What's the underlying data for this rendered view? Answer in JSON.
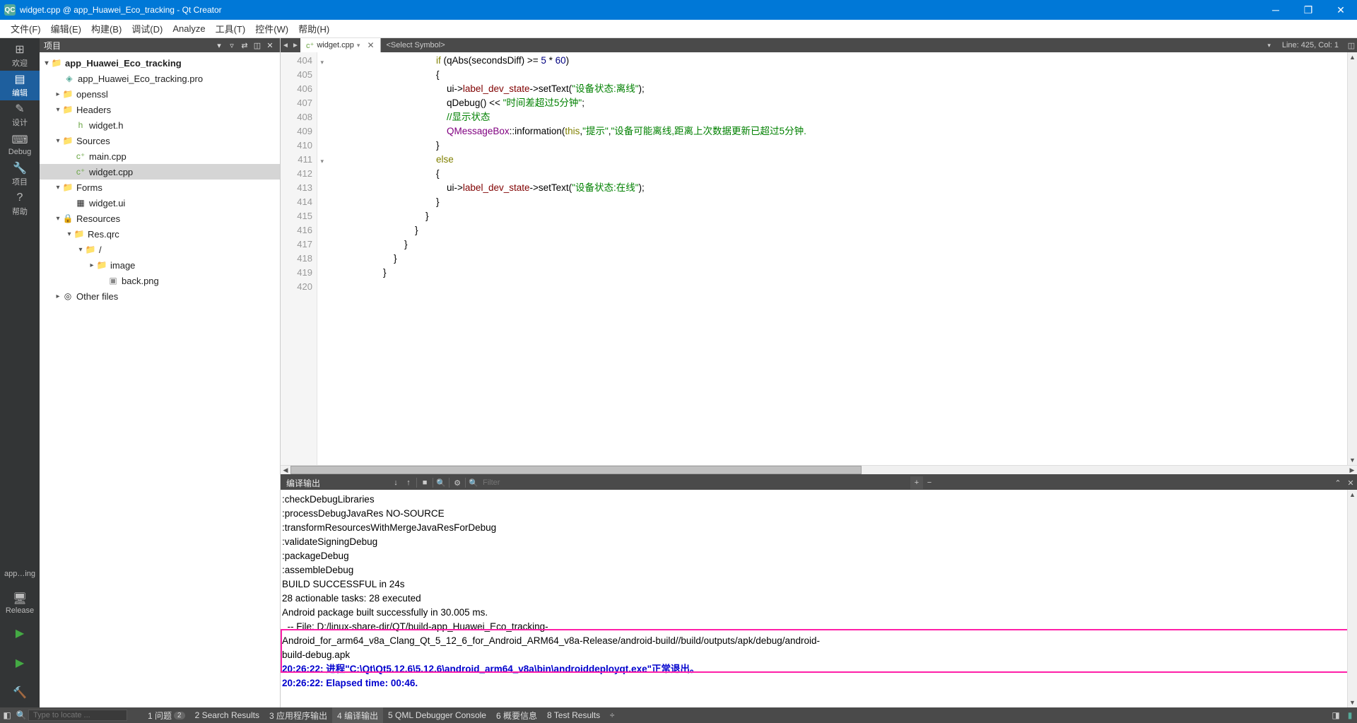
{
  "window": {
    "title": "widget.cpp @ app_Huawei_Eco_tracking - Qt Creator",
    "logo": "QC"
  },
  "menu": {
    "file": "文件(F)",
    "edit": "编辑(E)",
    "build": "构建(B)",
    "debug": "调试(D)",
    "analyze": "Analyze",
    "tools": "工具(T)",
    "widgets": "控件(W)",
    "help": "帮助(H)"
  },
  "sidebar": {
    "welcome": "欢迎",
    "edit": "编辑",
    "design": "设计",
    "debug": "Debug",
    "project": "项目",
    "help": "帮助",
    "kit": "app…ing",
    "release": "Release"
  },
  "projpanel": {
    "header": "项目",
    "tree": {
      "root": "app_Huawei_Eco_tracking",
      "pro": "app_Huawei_Eco_tracking.pro",
      "openssl": "openssl",
      "headers": "Headers",
      "widget_h": "widget.h",
      "sources": "Sources",
      "main_cpp": "main.cpp",
      "widget_cpp": "widget.cpp",
      "forms": "Forms",
      "widget_ui": "widget.ui",
      "resources": "Resources",
      "res_qrc": "Res.qrc",
      "slash": "/",
      "image": "image",
      "back_png": "back.png",
      "other": "Other files"
    }
  },
  "tabs": {
    "current": "widget.cpp",
    "combo": "<Select Symbol>",
    "lineinfo": "Line: 425, Col: 1"
  },
  "code": {
    "lines": [
      404,
      405,
      406,
      407,
      408,
      409,
      410,
      411,
      412,
      413,
      414,
      415,
      416,
      417,
      418,
      419,
      420
    ],
    "l404": "                                        if (qAbs(secondsDiff) >= 5 * 60)",
    "l405": "                                        {",
    "l406_a": "                                            ui->",
    "l406_b": "label_dev_state",
    "l406_c": "->setText(",
    "l406_d": "\"设备状态:离线\"",
    "l406_e": ");",
    "l407_a": "                                            qDebug() << ",
    "l407_b": "\"时间差超过5分钟\"",
    "l407_c": ";",
    "l408": "                                            //显示状态",
    "l409_a": "                                            QMessageBox::information(",
    "l409_b": "this",
    "l409_c": ",",
    "l409_d": "\"提示\"",
    "l409_e": ",",
    "l409_f": "\"设备可能离线,距离上次数据更新已超过5分钟.",
    "l410": "                                        }",
    "l411": "                                        else",
    "l412": "                                        {",
    "l413_a": "                                            ui->",
    "l413_b": "label_dev_state",
    "l413_c": "->setText(",
    "l413_d": "\"设备状态:在线\"",
    "l413_e": ");",
    "l414": "                                        }",
    "l415": "",
    "l416": "                                    }",
    "l417": "                                }",
    "l418": "                            }",
    "l419": "                        }",
    "l420": "                    }"
  },
  "output": {
    "header": "编译输出",
    "filter_placeholder": "Filter",
    "lines": {
      "l1": ":checkDebugLibraries",
      "l2": ":processDebugJavaRes NO-SOURCE",
      "l3": ":transformResourcesWithMergeJavaResForDebug",
      "l4": ":validateSigningDebug",
      "l5": ":packageDebug",
      "l6": ":assembleDebug",
      "l7": "",
      "l8": "BUILD SUCCESSFUL in 24s",
      "l9": "28 actionable tasks: 28 executed",
      "l10": "Android package built successfully in 30.005 ms.",
      "l11": "  -- File: D:/linux-share-dir/QT/build-app_Huawei_Eco_tracking-",
      "l12": "Android_for_arm64_v8a_Clang_Qt_5_12_6_for_Android_ARM64_v8a-Release/android-build//build/outputs/apk/debug/android-",
      "l13": "build-debug.apk",
      "l14": "20:26:22: 进程\"C:\\Qt\\Qt5.12.6\\5.12.6\\android_arm64_v8a\\bin\\androiddeployqt.exe\"正常退出。",
      "l15": "20:26:22: Elapsed time: 00:46."
    }
  },
  "status": {
    "locator_placeholder": "Type to locate ...",
    "issues": "1 问题",
    "issues_badge": "2",
    "search": "2 Search Results",
    "appout": "3 应用程序输出",
    "compile": "4 编译输出",
    "qml": "5 QML Debugger Console",
    "info": "6 概要信息",
    "test": "8 Test Results"
  }
}
